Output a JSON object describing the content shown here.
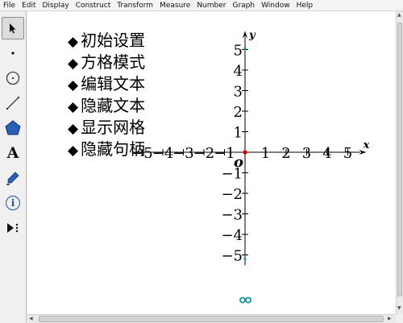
{
  "menubar": {
    "items": [
      "File",
      "Edit",
      "Display",
      "Construct",
      "Transform",
      "Measure",
      "Number",
      "Graph",
      "Window",
      "Help"
    ]
  },
  "toolbox": {
    "tools": [
      "arrow-tool-icon",
      "point-tool-icon",
      "compass-tool-icon",
      "straightedge-tool-icon",
      "polygon-tool-icon",
      "text-tool-icon",
      "marker-tool-icon",
      "information-tool-icon",
      "custom-tool-icon"
    ],
    "selected": "arrow-tool-icon",
    "text_tool_glyph": "A",
    "info_tool_glyph": "i"
  },
  "menu_list": {
    "bullet": "◆",
    "items": [
      "初始设置",
      "方格模式",
      "编辑文本",
      "隐藏文本",
      "显示网格",
      "隐藏句柄"
    ]
  },
  "graph": {
    "x_label": "x",
    "y_label": "y",
    "origin_label": "o",
    "x_range": [
      -5,
      5
    ],
    "y_range": [
      -5,
      5
    ],
    "x_tick_labels": [
      "−5",
      "−4",
      "−3",
      "−2",
      "−1",
      "1",
      "2",
      "3",
      "4",
      "5"
    ],
    "y_tick_labels": [
      "5",
      "4",
      "3",
      "2",
      "1",
      "−1",
      "−2",
      "−3",
      "−4",
      "−5"
    ],
    "origin_point_color": "#cc0000",
    "handle_color": "#1a9aa5",
    "axis_color": "#000000"
  }
}
